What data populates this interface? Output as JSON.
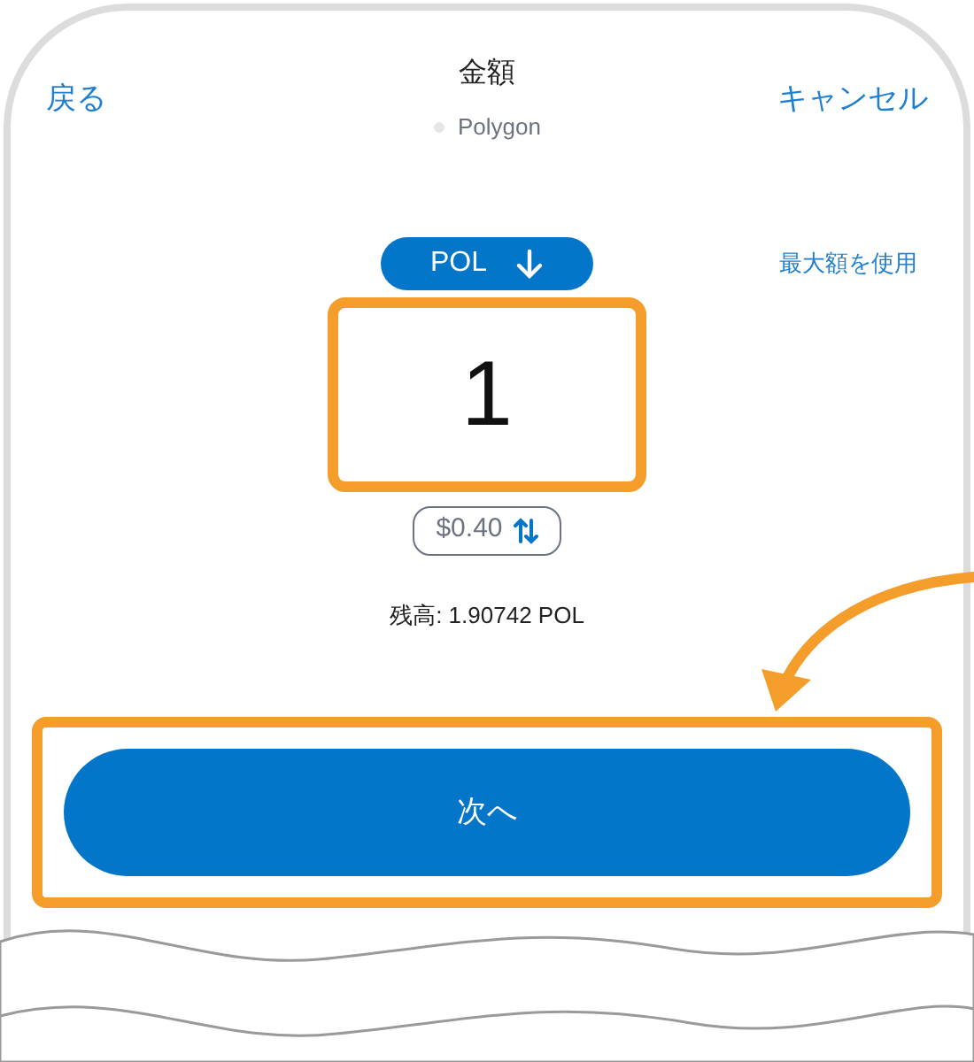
{
  "header": {
    "back": "戻る",
    "title": "金額",
    "network": "Polygon",
    "cancel": "キャンセル"
  },
  "token": {
    "symbol": "POL"
  },
  "max_link": "最大額を使用",
  "amount": {
    "value": "1",
    "highlighted": true
  },
  "fiat": "$0.40",
  "balance": "残高: 1.90742 POL",
  "next_button": {
    "label": "次へ",
    "highlighted": true
  }
}
